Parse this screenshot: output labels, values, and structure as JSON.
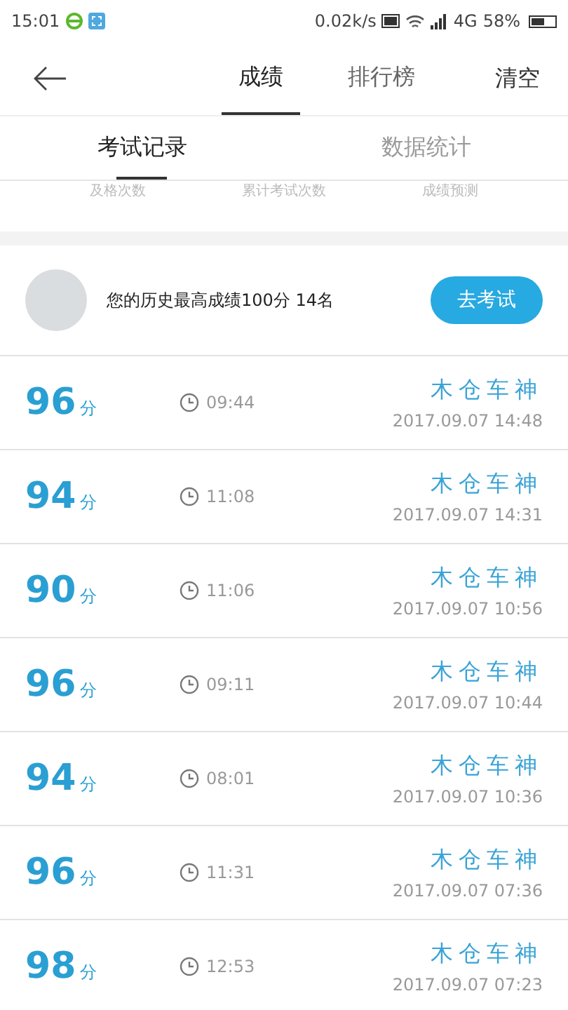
{
  "status_bar": {
    "time": "15:01",
    "speed": "0.02k/s",
    "network": "4G",
    "battery": "58%"
  },
  "header": {
    "tabs": [
      {
        "label": "成绩",
        "selected": true
      },
      {
        "label": "排行榜",
        "selected": false
      }
    ],
    "action": "清空"
  },
  "sub_tabs": [
    {
      "label": "考试记录",
      "selected": true
    },
    {
      "label": "数据统计",
      "selected": false
    }
  ],
  "stats_labels": [
    "及格次数",
    "累计考试次数",
    "成绩预测"
  ],
  "summary": {
    "text": "您的历史最高成绩100分 14名",
    "button": "去考试"
  },
  "records": [
    {
      "score": "96",
      "unit": "分",
      "duration": "09:44",
      "title": "木仓车神",
      "date": "2017.09.07 14:48"
    },
    {
      "score": "94",
      "unit": "分",
      "duration": "11:08",
      "title": "木仓车神",
      "date": "2017.09.07 14:31"
    },
    {
      "score": "90",
      "unit": "分",
      "duration": "11:06",
      "title": "木仓车神",
      "date": "2017.09.07 10:56"
    },
    {
      "score": "96",
      "unit": "分",
      "duration": "09:11",
      "title": "木仓车神",
      "date": "2017.09.07 10:44"
    },
    {
      "score": "94",
      "unit": "分",
      "duration": "08:01",
      "title": "木仓车神",
      "date": "2017.09.07 10:36"
    },
    {
      "score": "96",
      "unit": "分",
      "duration": "11:31",
      "title": "木仓车神",
      "date": "2017.09.07 07:36"
    },
    {
      "score": "98",
      "unit": "分",
      "duration": "12:53",
      "title": "木仓车神",
      "date": "2017.09.07 07:23"
    }
  ]
}
